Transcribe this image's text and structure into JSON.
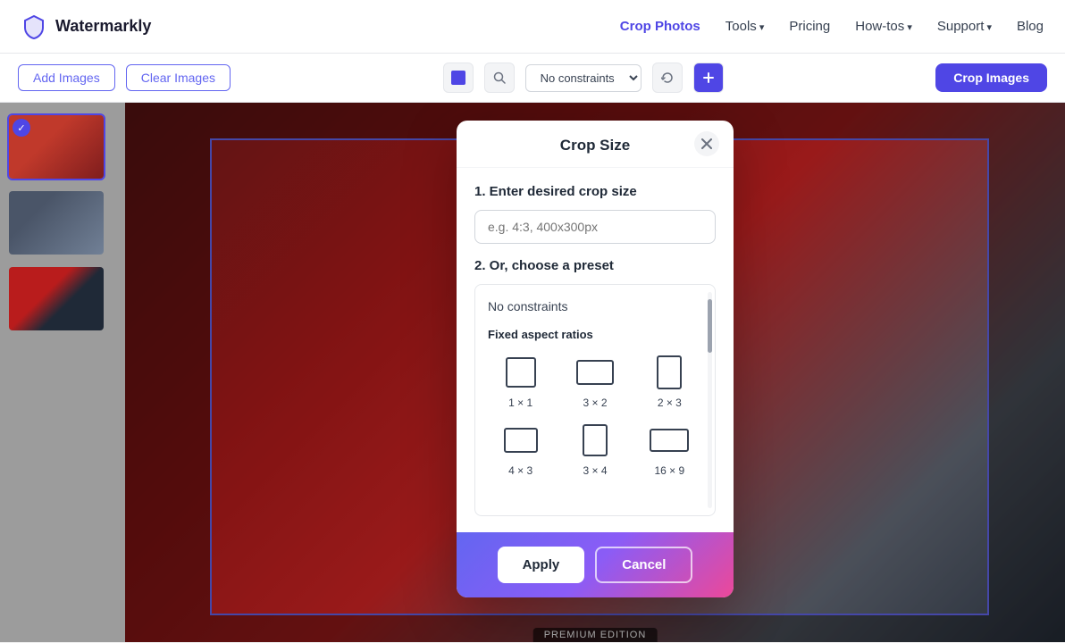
{
  "app": {
    "logo_text": "Watermarkly",
    "logo_icon": "shield"
  },
  "nav": {
    "crop_photos": "Crop Photos",
    "tools": "Tools",
    "pricing": "Pricing",
    "how_tos": "How-tos",
    "support": "Support",
    "blog": "Blog"
  },
  "toolbar": {
    "add_images": "Add Images",
    "clear_images": "Clear Images",
    "no_constraints": "No constraints",
    "crop_images": "Crop Images"
  },
  "modal": {
    "title": "Crop Size",
    "section1": "1. Enter desired crop size",
    "input_placeholder": "e.g. 4:3, 400x300px",
    "section2": "2. Or, choose a preset",
    "no_constraints": "No constraints",
    "fixed_aspect_ratios": "Fixed aspect ratios",
    "presets": [
      {
        "label": "1 × 1",
        "shape": "square"
      },
      {
        "label": "3 × 2",
        "shape": "landscape"
      },
      {
        "label": "2 × 3",
        "shape": "portrait"
      },
      {
        "label": "4 × 3",
        "shape": "landscape2"
      },
      {
        "label": "3 × 4",
        "shape": "portrait2"
      },
      {
        "label": "16 × 9",
        "shape": "landscape3"
      }
    ],
    "apply_btn": "Apply",
    "cancel_btn": "Cancel"
  },
  "premium": {
    "label": "PREMIUM EDITION"
  }
}
